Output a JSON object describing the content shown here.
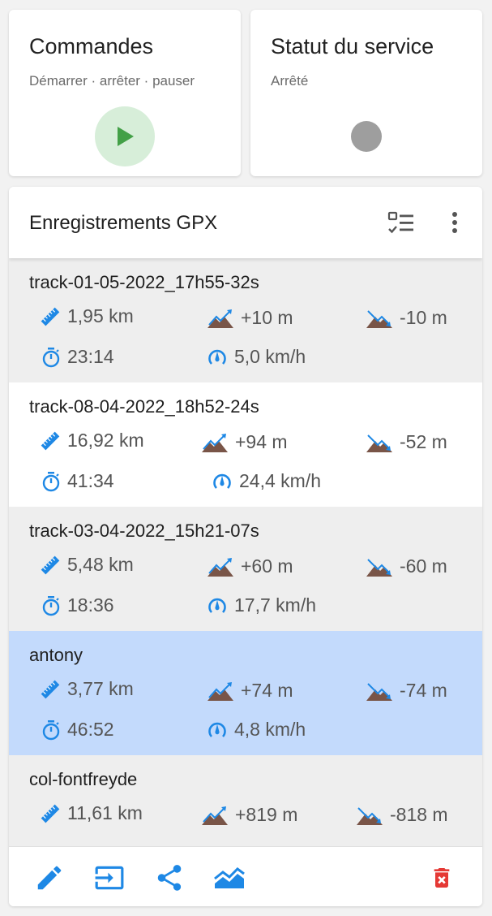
{
  "commands": {
    "title": "Commandes",
    "subtitle": "Démarrer · arrêter · pauser"
  },
  "service": {
    "title": "Statut du service",
    "status": "Arrêté"
  },
  "gpx": {
    "title": "Enregistrements GPX",
    "tracks": [
      {
        "name": "track-01-05-2022_17h55-32s",
        "distance": "1,95 km",
        "ascent": "+10 m",
        "descent": "-10 m",
        "duration": "23:14",
        "speed": "5,0 km/h"
      },
      {
        "name": "track-08-04-2022_18h52-24s",
        "distance": "16,92 km",
        "ascent": "+94 m",
        "descent": "-52 m",
        "duration": "41:34",
        "speed": "24,4 km/h"
      },
      {
        "name": "track-03-04-2022_15h21-07s",
        "distance": "5,48 km",
        "ascent": "+60 m",
        "descent": "-60 m",
        "duration": "18:36",
        "speed": "17,7 km/h"
      },
      {
        "name": "antony",
        "distance": "3,77 km",
        "ascent": "+74 m",
        "descent": "-74 m",
        "duration": "46:52",
        "speed": "4,8 km/h"
      },
      {
        "name": "col-fontfreyde",
        "distance": "11,61 km",
        "ascent": "+819 m",
        "descent": "-818 m",
        "duration": "",
        "speed": ""
      }
    ]
  },
  "colors": {
    "accent": "#1e88e5",
    "play": "#43a047",
    "delete": "#e53935",
    "mountain": "#795548",
    "selected": "#c3dafc"
  },
  "icons": [
    "play-icon",
    "checklist-icon",
    "more-vert-icon",
    "ruler-icon",
    "ascent-icon",
    "descent-icon",
    "timer-icon",
    "speed-icon",
    "edit-icon",
    "import-icon",
    "share-icon",
    "chart-icon",
    "delete-icon"
  ]
}
